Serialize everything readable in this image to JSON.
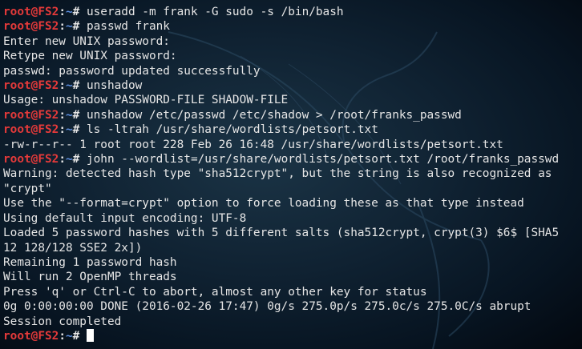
{
  "prompt": {
    "user_host": "root@FS2",
    "colon": ":",
    "path": "~",
    "symbol": "# "
  },
  "lines": [
    {
      "type": "cmd",
      "text": "useradd -m frank -G sudo -s /bin/bash"
    },
    {
      "type": "cmd",
      "text": "passwd frank"
    },
    {
      "type": "out",
      "text": "Enter new UNIX password:"
    },
    {
      "type": "out",
      "text": "Retype new UNIX password:"
    },
    {
      "type": "out",
      "text": "passwd: password updated successfully"
    },
    {
      "type": "cmd",
      "text": "unshadow"
    },
    {
      "type": "out",
      "text": "Usage: unshadow PASSWORD-FILE SHADOW-FILE"
    },
    {
      "type": "cmd",
      "text": "unshadow /etc/passwd /etc/shadow > /root/franks_passwd"
    },
    {
      "type": "cmd",
      "text": "ls -ltrah /usr/share/wordlists/petsort.txt"
    },
    {
      "type": "out",
      "text": "-rw-r--r-- 1 root root 228 Feb 26 16:48 /usr/share/wordlists/petsort.txt"
    },
    {
      "type": "cmd",
      "text": "john --wordlist=/usr/share/wordlists/petsort.txt /root/franks_passwd"
    },
    {
      "type": "out",
      "text": "Warning: detected hash type \"sha512crypt\", but the string is also recognized as"
    },
    {
      "type": "out",
      "text": "\"crypt\""
    },
    {
      "type": "out",
      "text": "Use the \"--format=crypt\" option to force loading these as that type instead"
    },
    {
      "type": "out",
      "text": "Using default input encoding: UTF-8"
    },
    {
      "type": "out",
      "text": "Loaded 5 password hashes with 5 different salts (sha512crypt, crypt(3) $6$ [SHA5"
    },
    {
      "type": "out",
      "text": "12 128/128 SSE2 2x])"
    },
    {
      "type": "out",
      "text": "Remaining 1 password hash"
    },
    {
      "type": "out",
      "text": "Will run 2 OpenMP threads"
    },
    {
      "type": "out",
      "text": "Press 'q' or Ctrl-C to abort, almost any other key for status"
    },
    {
      "type": "out",
      "text": "0g 0:00:00:00 DONE (2016-02-26 17:47) 0g/s 275.0p/s 275.0c/s 275.0C/s abrupt"
    },
    {
      "type": "out",
      "text": "Session completed"
    },
    {
      "type": "prompt",
      "text": ""
    }
  ],
  "colors": {
    "prompt_user": "#e53a3a",
    "prompt_path": "#5d8fe0",
    "text": "#e6e6e6",
    "background": "#0f2131"
  }
}
